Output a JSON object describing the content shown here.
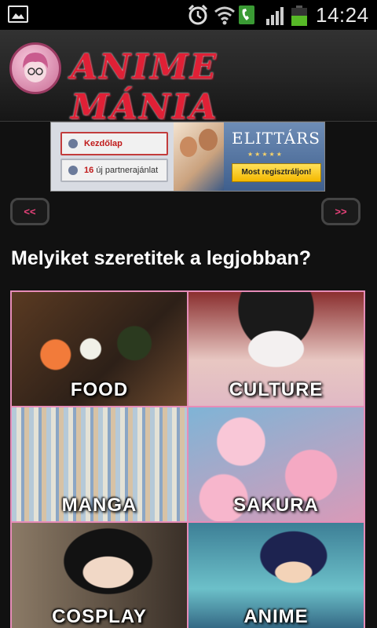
{
  "status_bar": {
    "time": "14:24",
    "icons": [
      "picture-icon",
      "alarm-icon",
      "wifi-icon",
      "call-icon",
      "signal-icon",
      "battery-icon"
    ],
    "battery_level": 0.55
  },
  "header": {
    "logo_title": "ANIME MÁNIA",
    "accent_color": "#e02036"
  },
  "ad": {
    "home_label": "Kezdőlap",
    "offers_count": "16",
    "offers_label": "új partnerajánlat",
    "brand": "ELITTÁRS",
    "stars": "★★★★★",
    "cta_label": "Most regisztráljon!"
  },
  "nav": {
    "prev_label": "<<",
    "next_label": ">>"
  },
  "main": {
    "heading": "Melyiket szeretitek a legjobban?",
    "tiles": [
      {
        "label": "FOOD"
      },
      {
        "label": "CULTURE"
      },
      {
        "label": "MANGA"
      },
      {
        "label": "SAKURA"
      },
      {
        "label": "COSPLAY"
      },
      {
        "label": "ANIME"
      }
    ],
    "border_color": "#e68cb8"
  }
}
